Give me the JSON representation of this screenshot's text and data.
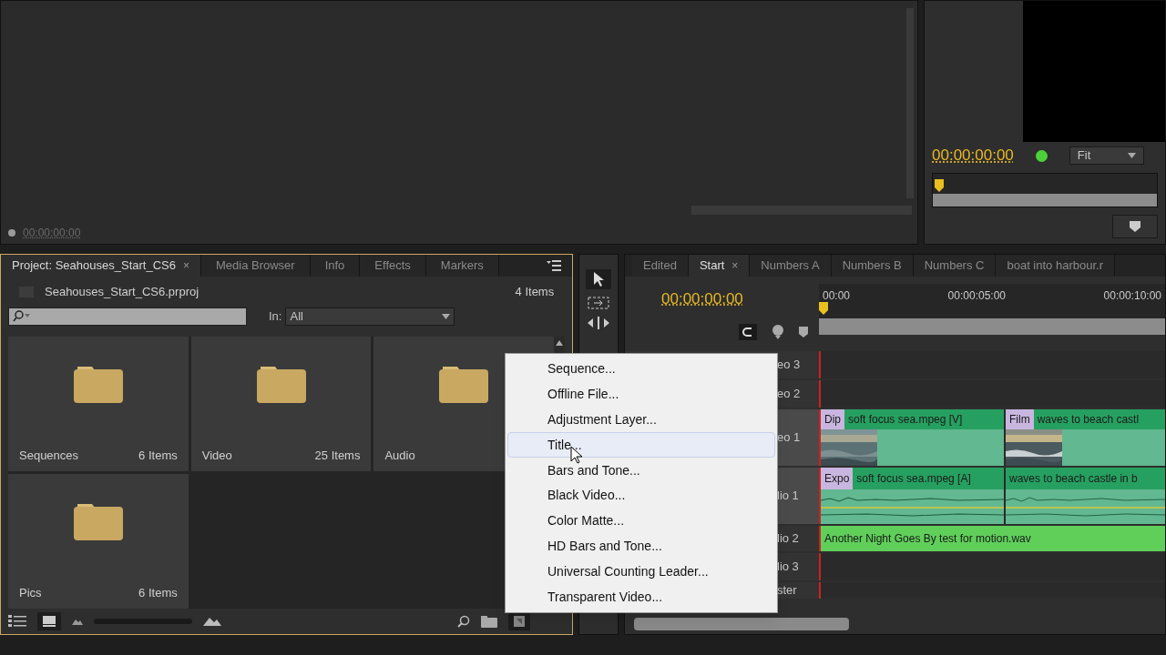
{
  "source_monitor": {
    "timecode": "00:00:00:00"
  },
  "program_monitor": {
    "timecode": "00:00:00:00",
    "zoom": "Fit"
  },
  "project_panel": {
    "tabs": [
      {
        "label": "Project: Seahouses_Start_CS6",
        "selected": true,
        "close": "×"
      },
      {
        "label": "Media Browser",
        "selected": false
      },
      {
        "label": "Info",
        "selected": false
      },
      {
        "label": "Effects",
        "selected": false
      },
      {
        "label": "Markers",
        "selected": false
      }
    ],
    "file": "Seahouses_Start_CS6.prproj",
    "count": "4 Items",
    "in_label": "In:",
    "in_value": "All",
    "bins": [
      {
        "name": "Sequences",
        "count": "6 Items"
      },
      {
        "name": "Video",
        "count": "25 Items"
      },
      {
        "name": "Audio"
      },
      {
        "name": "Pics",
        "count": "6 Items"
      }
    ]
  },
  "timeline": {
    "tabs": [
      {
        "label": "Edited",
        "selected": false
      },
      {
        "label": "Start",
        "selected": true,
        "close": "×"
      },
      {
        "label": "Numbers A",
        "selected": false
      },
      {
        "label": "Numbers B",
        "selected": false
      },
      {
        "label": "Numbers C",
        "selected": false
      },
      {
        "label": "boat into harbour.r",
        "selected": false
      }
    ],
    "timecode": "00:00:00:00",
    "ruler": [
      "00:00",
      "00:00:05:00",
      "00:00:10:00"
    ],
    "tracks": [
      {
        "label": "eo 3",
        "kind": "empty"
      },
      {
        "label": "eo 2",
        "kind": "empty"
      },
      {
        "label": "eo 1",
        "kind": "video",
        "clips": [
          {
            "transition": "Dip",
            "name": "soft focus sea.mpeg [V]"
          },
          {
            "transition": "Film",
            "name": "waves to beach castl"
          }
        ]
      },
      {
        "label": "lio 1",
        "kind": "audio",
        "clips": [
          {
            "transition": "Expo",
            "name": "soft focus sea.mpeg [A]"
          },
          {
            "name": "waves to beach castle in b"
          }
        ]
      },
      {
        "label": "lio 2",
        "kind": "music",
        "clips": [
          {
            "name": "Another Night Goes By test for motion.wav"
          }
        ]
      },
      {
        "label": "lio 3",
        "kind": "empty"
      },
      {
        "label": "ster",
        "kind": "master"
      }
    ]
  },
  "menu": {
    "items": [
      {
        "label": "Sequence...",
        "selected": false
      },
      {
        "label": "Offline File...",
        "selected": false
      },
      {
        "label": "Adjustment Layer...",
        "selected": false
      },
      {
        "label": "Title...",
        "selected": true
      },
      {
        "label": "Bars and Tone...",
        "selected": false
      },
      {
        "label": "Black Video...",
        "selected": false
      },
      {
        "label": "Color Matte...",
        "selected": false
      },
      {
        "label": "HD Bars and Tone...",
        "selected": false
      },
      {
        "label": "Universal Counting Leader...",
        "selected": false
      },
      {
        "label": "Transparent Video...",
        "selected": false
      }
    ]
  }
}
